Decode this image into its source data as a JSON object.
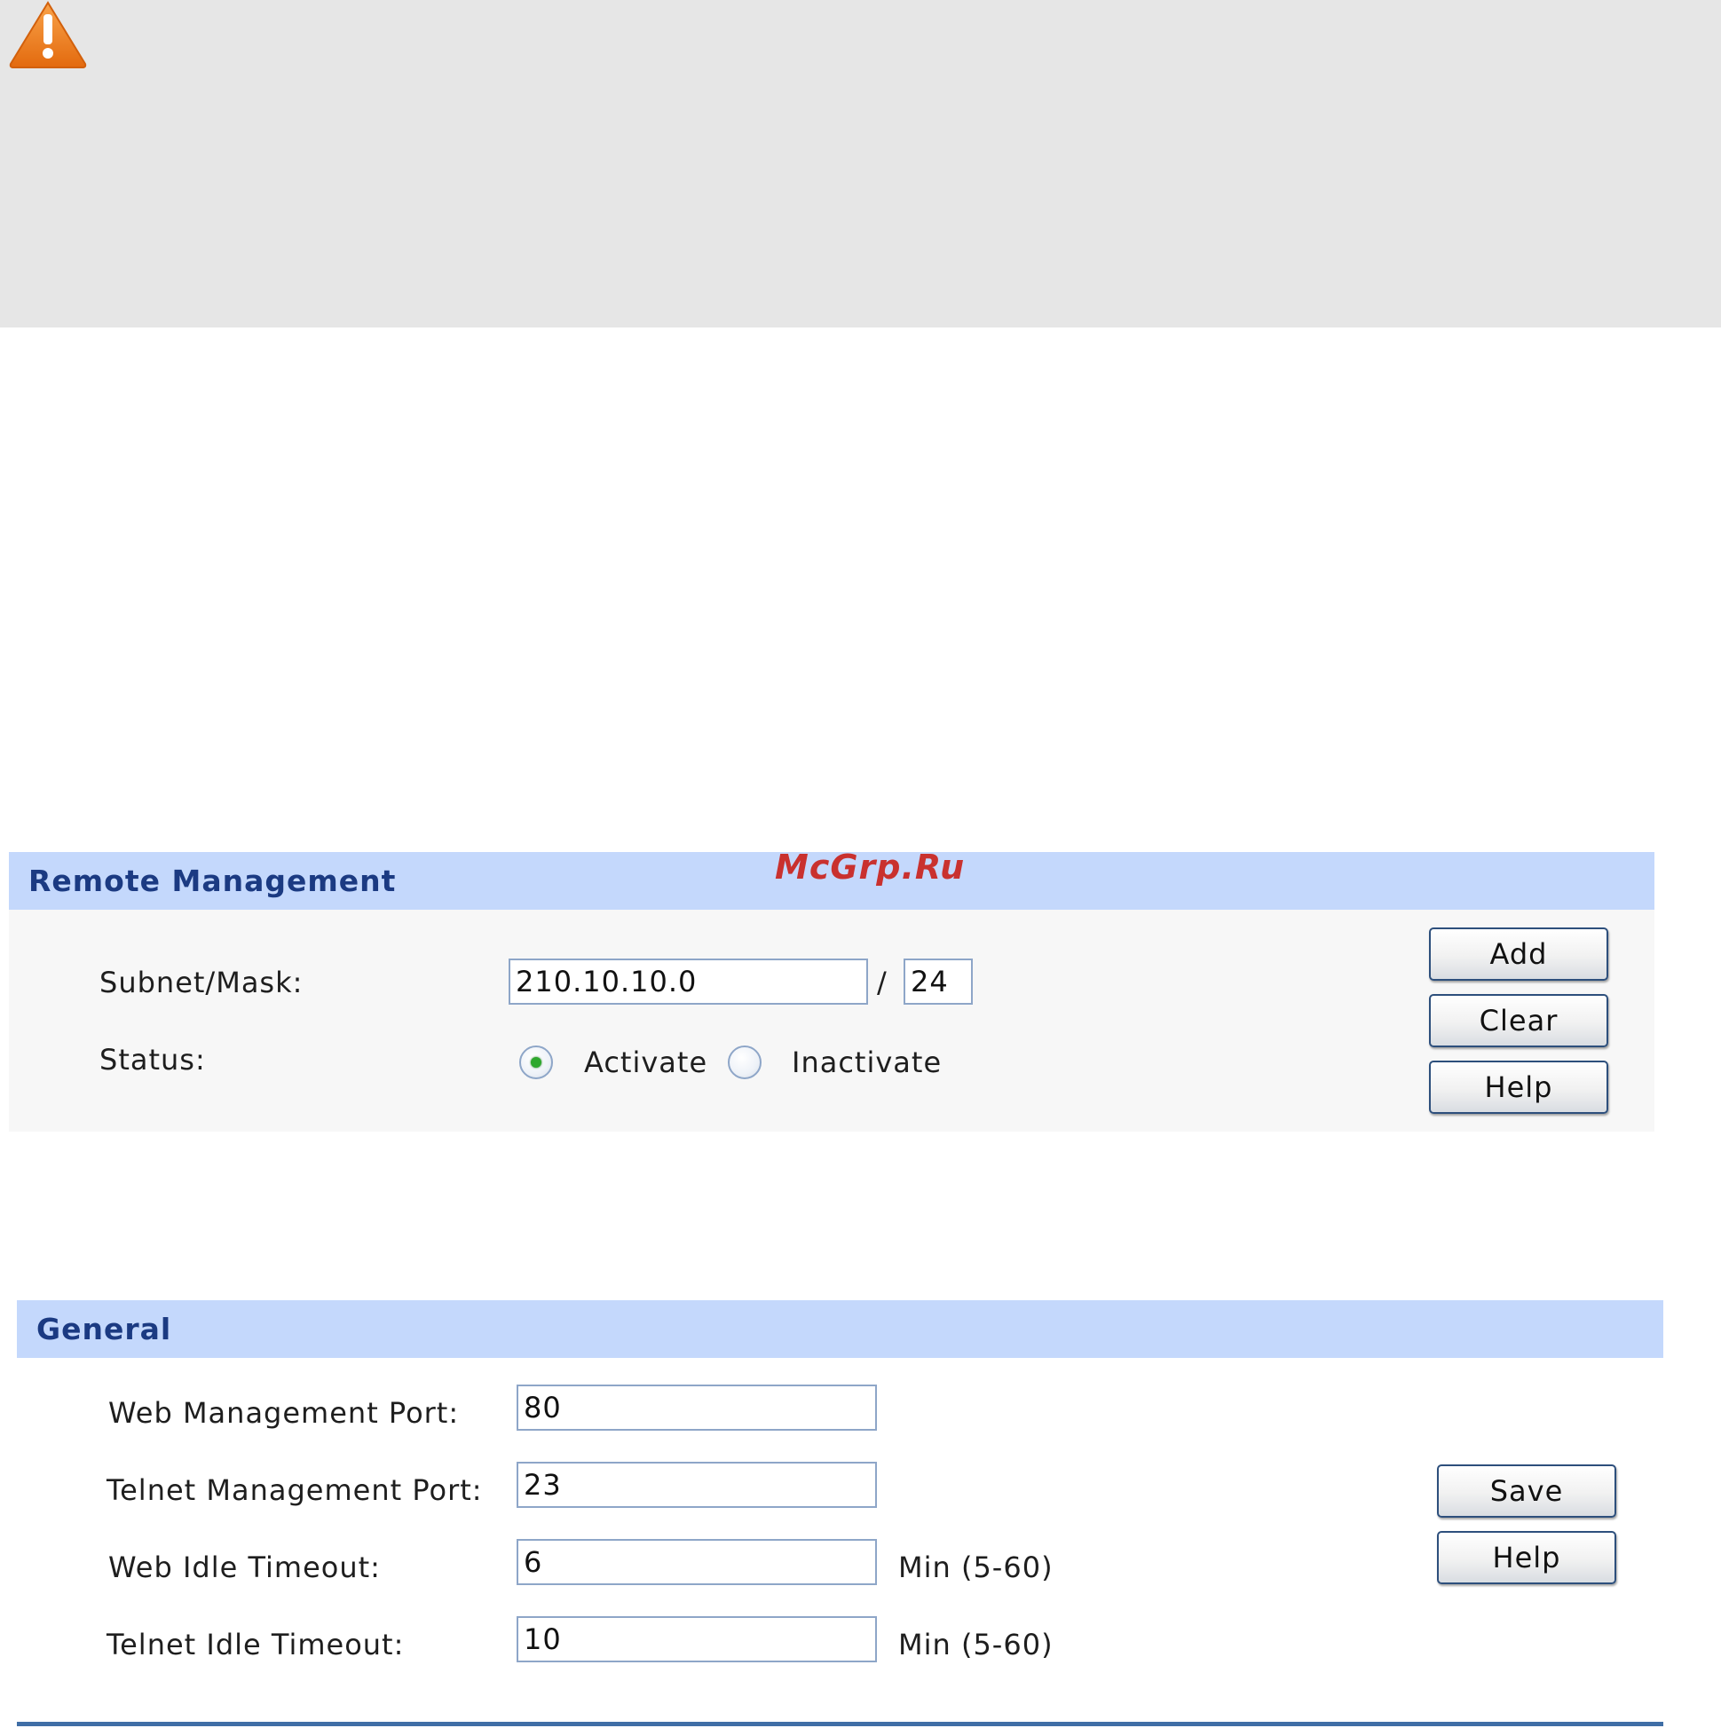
{
  "warning": {
    "icon": "warning-triangle-icon"
  },
  "watermark": "McGrp.Ru",
  "remote_management": {
    "title": "Remote Management",
    "subnet_label": "Subnet/Mask:",
    "subnet_value": "210.10.10.0",
    "mask_separator": "/",
    "mask_value": "24",
    "status_label": "Status:",
    "status_options": [
      "Activate",
      "Inactivate"
    ],
    "status_selected": "Activate",
    "buttons": {
      "add": "Add",
      "clear": "Clear",
      "help": "Help"
    }
  },
  "general": {
    "title": "General",
    "fields": [
      {
        "label": "Web Management Port:",
        "value": "80",
        "suffix": ""
      },
      {
        "label": "Telnet Management Port:",
        "value": "23",
        "suffix": ""
      },
      {
        "label": "Web Idle Timeout:",
        "value": "6",
        "suffix": "Min (5-60)"
      },
      {
        "label": "Telnet Idle Timeout:",
        "value": "10",
        "suffix": "Min (5-60)"
      }
    ],
    "buttons": {
      "save": "Save",
      "help": "Help"
    }
  },
  "colors": {
    "header_bg": "#c4d8fc",
    "header_text": "#1b3a82",
    "warning_bg": "#e6e6e6",
    "warning_icon": "#ef7f1a",
    "radio_selected": "#2ea82e",
    "rule": "#3f6ea6"
  }
}
